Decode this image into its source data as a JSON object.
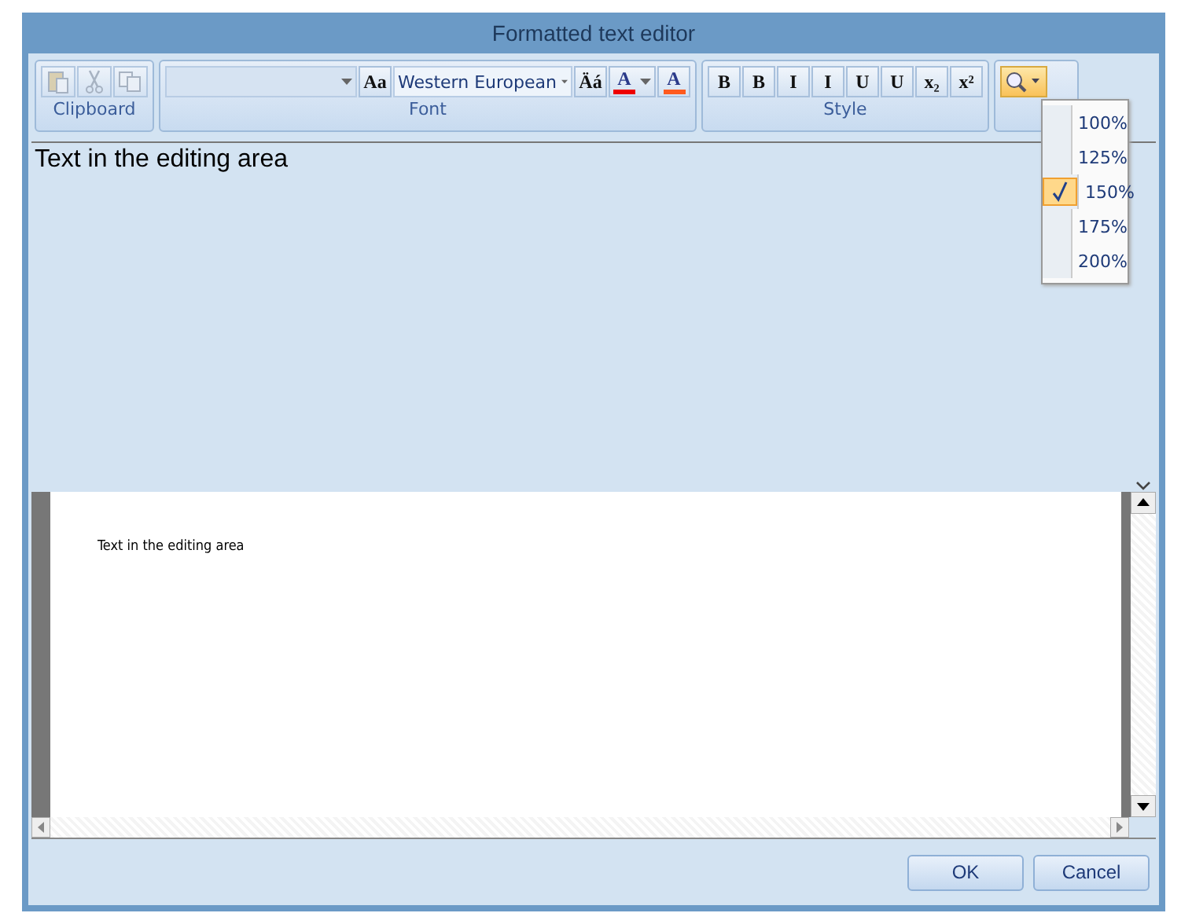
{
  "window": {
    "title": "Formatted text editor"
  },
  "ribbon": {
    "groups": [
      {
        "label": "Clipboard",
        "tools": [
          {
            "kind": "paste",
            "disabled": true
          },
          {
            "kind": "cut",
            "disabled": true
          },
          {
            "kind": "copy",
            "disabled": true
          }
        ]
      },
      {
        "label": "Font",
        "tools": [
          {
            "kind": "font_combo"
          },
          {
            "kind": "glyph",
            "glyph": "Aa"
          },
          {
            "kind": "charset_combo",
            "value": "Western European"
          },
          {
            "kind": "glyph",
            "glyph": "Äá"
          },
          {
            "kind": "color",
            "glyph": "A",
            "color": "#ee0000",
            "dropdown": true
          },
          {
            "kind": "color",
            "glyph": "A",
            "color": "#ff5a1e",
            "dropdown": false
          }
        ]
      },
      {
        "label": "Style",
        "tools": [
          {
            "kind": "glyph",
            "glyph": "B"
          },
          {
            "kind": "glyph",
            "glyph": "B"
          },
          {
            "kind": "glyph",
            "glyph": "I"
          },
          {
            "kind": "glyph",
            "glyph": "I"
          },
          {
            "kind": "glyph",
            "glyph": "U"
          },
          {
            "kind": "glyph",
            "glyph": "U"
          },
          {
            "kind": "glyph",
            "glyph": "x₂"
          },
          {
            "kind": "glyph",
            "glyph": "x²"
          }
        ]
      }
    ]
  },
  "zoom_menu": {
    "items": [
      {
        "label": "100%",
        "selected": false
      },
      {
        "label": "125%",
        "selected": false
      },
      {
        "label": "150%",
        "selected": true
      },
      {
        "label": "175%",
        "selected": false
      },
      {
        "label": "200%",
        "selected": false
      }
    ]
  },
  "editor": {
    "text": "Text in the editing area"
  },
  "preview": {
    "text": "Text in the editing area"
  },
  "buttons": [
    "OK",
    "Cancel"
  ]
}
